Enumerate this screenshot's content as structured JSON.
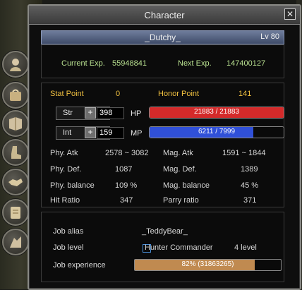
{
  "window": {
    "title": "Character",
    "close_glyph": "✕"
  },
  "character": {
    "name": "_Dutchy_",
    "level": "Lv 80"
  },
  "exp": {
    "current_label": "Current Exp.",
    "current_value": "55948841",
    "next_label": "Next Exp.",
    "next_value": "147400127"
  },
  "points": {
    "stat_label": "Stat Point",
    "stat_value": "0",
    "honor_label": "Honor Point",
    "honor_value": "141"
  },
  "stats": {
    "str": {
      "label": "Str",
      "value": "398",
      "bar_label": "HP",
      "bar_text": "21883 / 21883",
      "bar_fraction": 1.0,
      "color": "#d42a2a"
    },
    "int": {
      "label": "Int",
      "value": "159",
      "bar_label": "MP",
      "bar_text": "6211 / 7999",
      "bar_fraction": 0.776,
      "color": "#3050d8"
    },
    "plus_glyph": "+"
  },
  "attributes": [
    {
      "left_label": "Phy. Atk",
      "left_value": "2578 ~ 3082",
      "right_label": "Mag. Atk",
      "right_value": "1591 ~ 1844"
    },
    {
      "left_label": "Phy. Def.",
      "left_value": "1087",
      "right_label": "Mag. Def.",
      "right_value": "1389"
    },
    {
      "left_label": "Phy. balance",
      "left_value": "109 %",
      "right_label": "Mag. balance",
      "right_value": "45 %"
    },
    {
      "left_label": "Hit Ratio",
      "left_value": "347",
      "right_label": "Parry ratio",
      "right_value": "371"
    }
  ],
  "job": {
    "alias_label": "Job alias",
    "alias_value": "_TeddyBear_",
    "level_label": "Job level",
    "job_name": "Hunter Commander",
    "job_level": "4 level",
    "exp_label": "Job experience",
    "exp_text": "82% (31863265)",
    "exp_fraction": 0.82,
    "exp_color": "#c08a50"
  },
  "sidebar_icons": [
    "character-icon",
    "inventory-icon",
    "skill-book-icon",
    "equipment-icon",
    "guild-handshake-icon",
    "quest-scroll-icon",
    "party-icon"
  ]
}
